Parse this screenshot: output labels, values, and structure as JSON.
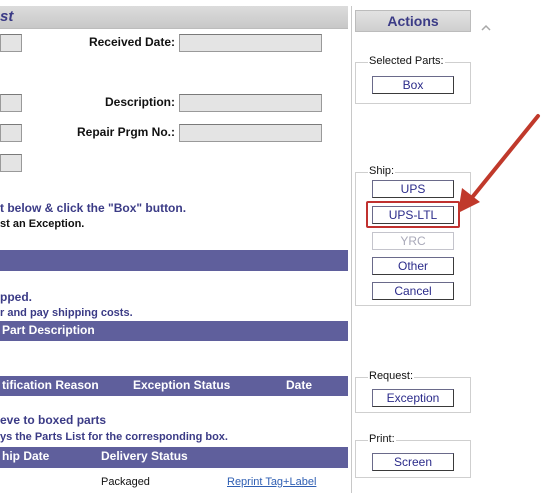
{
  "left": {
    "title_fragment": "st",
    "received_date_label": "Received Date:",
    "description_label": "Description:",
    "repair_prgm_label": "Repair Prgm No.:",
    "instruction_1": "t below & click the \"Box\" button.",
    "instruction_2": "st an Exception.",
    "shipped_title": "pped.",
    "shipped_note": "r and pay shipping costs.",
    "part_description_header": "Part Description",
    "exception_headers": {
      "reason": "tification Reason",
      "status": "Exception Status",
      "date": "Date"
    },
    "boxed_title": "eve to boxed parts",
    "boxed_note": "ys the Parts List for the corresponding box.",
    "boxed_headers": {
      "ship_date": "hip Date",
      "delivery_status": "Delivery Status"
    },
    "boxed_row": {
      "status": "Packaged",
      "link": "Reprint Tag+Label"
    }
  },
  "actions": {
    "title": "Actions",
    "selected_parts": {
      "label": "Selected Parts:",
      "box_button": "Box"
    },
    "ship": {
      "label": "Ship:",
      "ups_button": "UPS",
      "ups_ltl_button": "UPS-LTL",
      "yrc_button": "YRC",
      "other_button": "Other",
      "cancel_button": "Cancel"
    },
    "request": {
      "label": "Request:",
      "exception_button": "Exception"
    },
    "print": {
      "label": "Print:",
      "screen_button": "Screen"
    }
  },
  "colors": {
    "header_bar": "#5f5f9c",
    "title_text": "#3b3b86",
    "highlight_box": "#c0312f",
    "arrow": "#c0392b"
  }
}
